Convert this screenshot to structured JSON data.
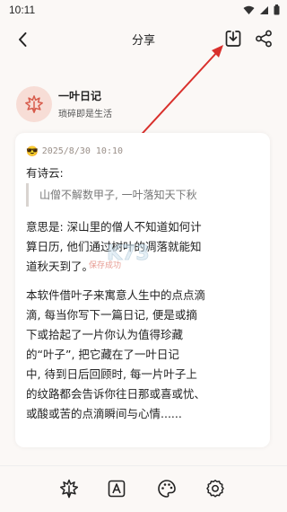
{
  "status_bar": {
    "time": "10:11"
  },
  "header": {
    "title": "分享"
  },
  "app": {
    "name": "一叶日记",
    "slogan": "琐碎即是生活"
  },
  "entry": {
    "emoji": "😎",
    "datetime": "2025/8/30 10:10",
    "lines": [
      "有诗云:",
      "意思是: 深山里的僧人不知道如何计",
      "算日历, 他们通过树叶的凋落就能知",
      "道秋天到了。",
      "本软件借叶子来寓意人生中的点点滴",
      "滴, 每当你写下一篇日记, 便是或摘",
      "下或拾起了一片你认为值得珍藏",
      "的“叶子”, 把它藏在了一叶日记",
      "中, 待到日后回顾时, 每一片叶子上",
      "的纹路都会告诉你往日那或喜或忧、",
      "或酸或苦的点滴瞬间与心情......"
    ],
    "quote": "山僧不解数甲子, 一叶落知天下秋"
  },
  "watermark": {
    "text": "K73",
    "subtext": "保存成功"
  },
  "colors": {
    "accent": "#d75a4a",
    "logo_bg": "#f7ddd6",
    "arrow": "#d9302c"
  }
}
